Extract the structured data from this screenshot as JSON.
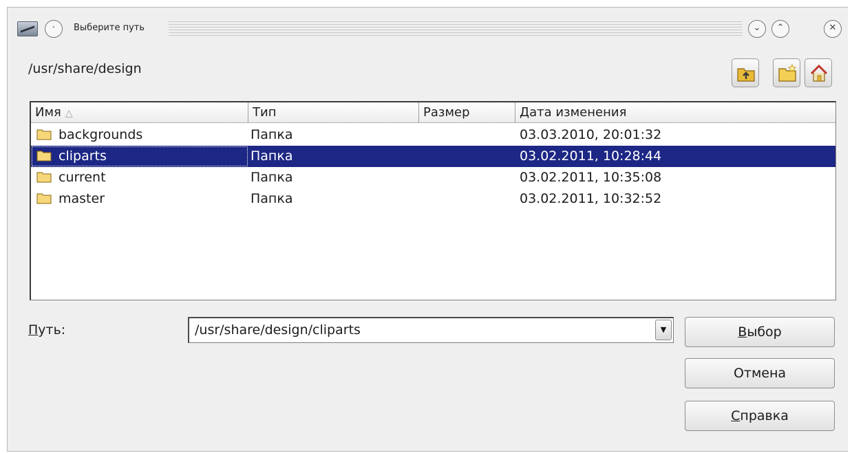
{
  "window": {
    "title": "Выберите путь",
    "menu_glyph": "·",
    "minimize_glyph": "⌄",
    "maximize_glyph": "⌃",
    "close_glyph": "✕"
  },
  "current_path": "/usr/share/design",
  "toolbar": {
    "icons": [
      "folder-up-icon",
      "new-folder-icon",
      "home-icon"
    ]
  },
  "file_list": {
    "columns": {
      "name": "Имя",
      "type": "Тип",
      "size": "Размер",
      "date": "Дата изменения"
    },
    "sort_indicator": "△",
    "rows": [
      {
        "name": "backgrounds",
        "type": "Папка",
        "size": "",
        "date": "03.03.2010, 20:01:32",
        "selected": false
      },
      {
        "name": "cliparts",
        "type": "Папка",
        "size": "",
        "date": "03.02.2011, 10:28:44",
        "selected": true
      },
      {
        "name": "current",
        "type": "Папка",
        "size": "",
        "date": "03.02.2011, 10:35:08",
        "selected": false
      },
      {
        "name": "master",
        "type": "Папка",
        "size": "",
        "date": "03.02.2011, 10:32:52",
        "selected": false
      }
    ]
  },
  "path_field": {
    "label_mnemonic": "П",
    "label_rest": "уть:",
    "value": "/usr/share/design/cliparts",
    "dropdown_glyph": "▼"
  },
  "buttons": {
    "select_mnemonic": "В",
    "select_rest": "ыбор",
    "cancel": "Отмена",
    "help_mnemonic": "С",
    "help_rest": "правка"
  },
  "colors": {
    "selection": "#1d2785",
    "folder": "#f2c94c"
  }
}
